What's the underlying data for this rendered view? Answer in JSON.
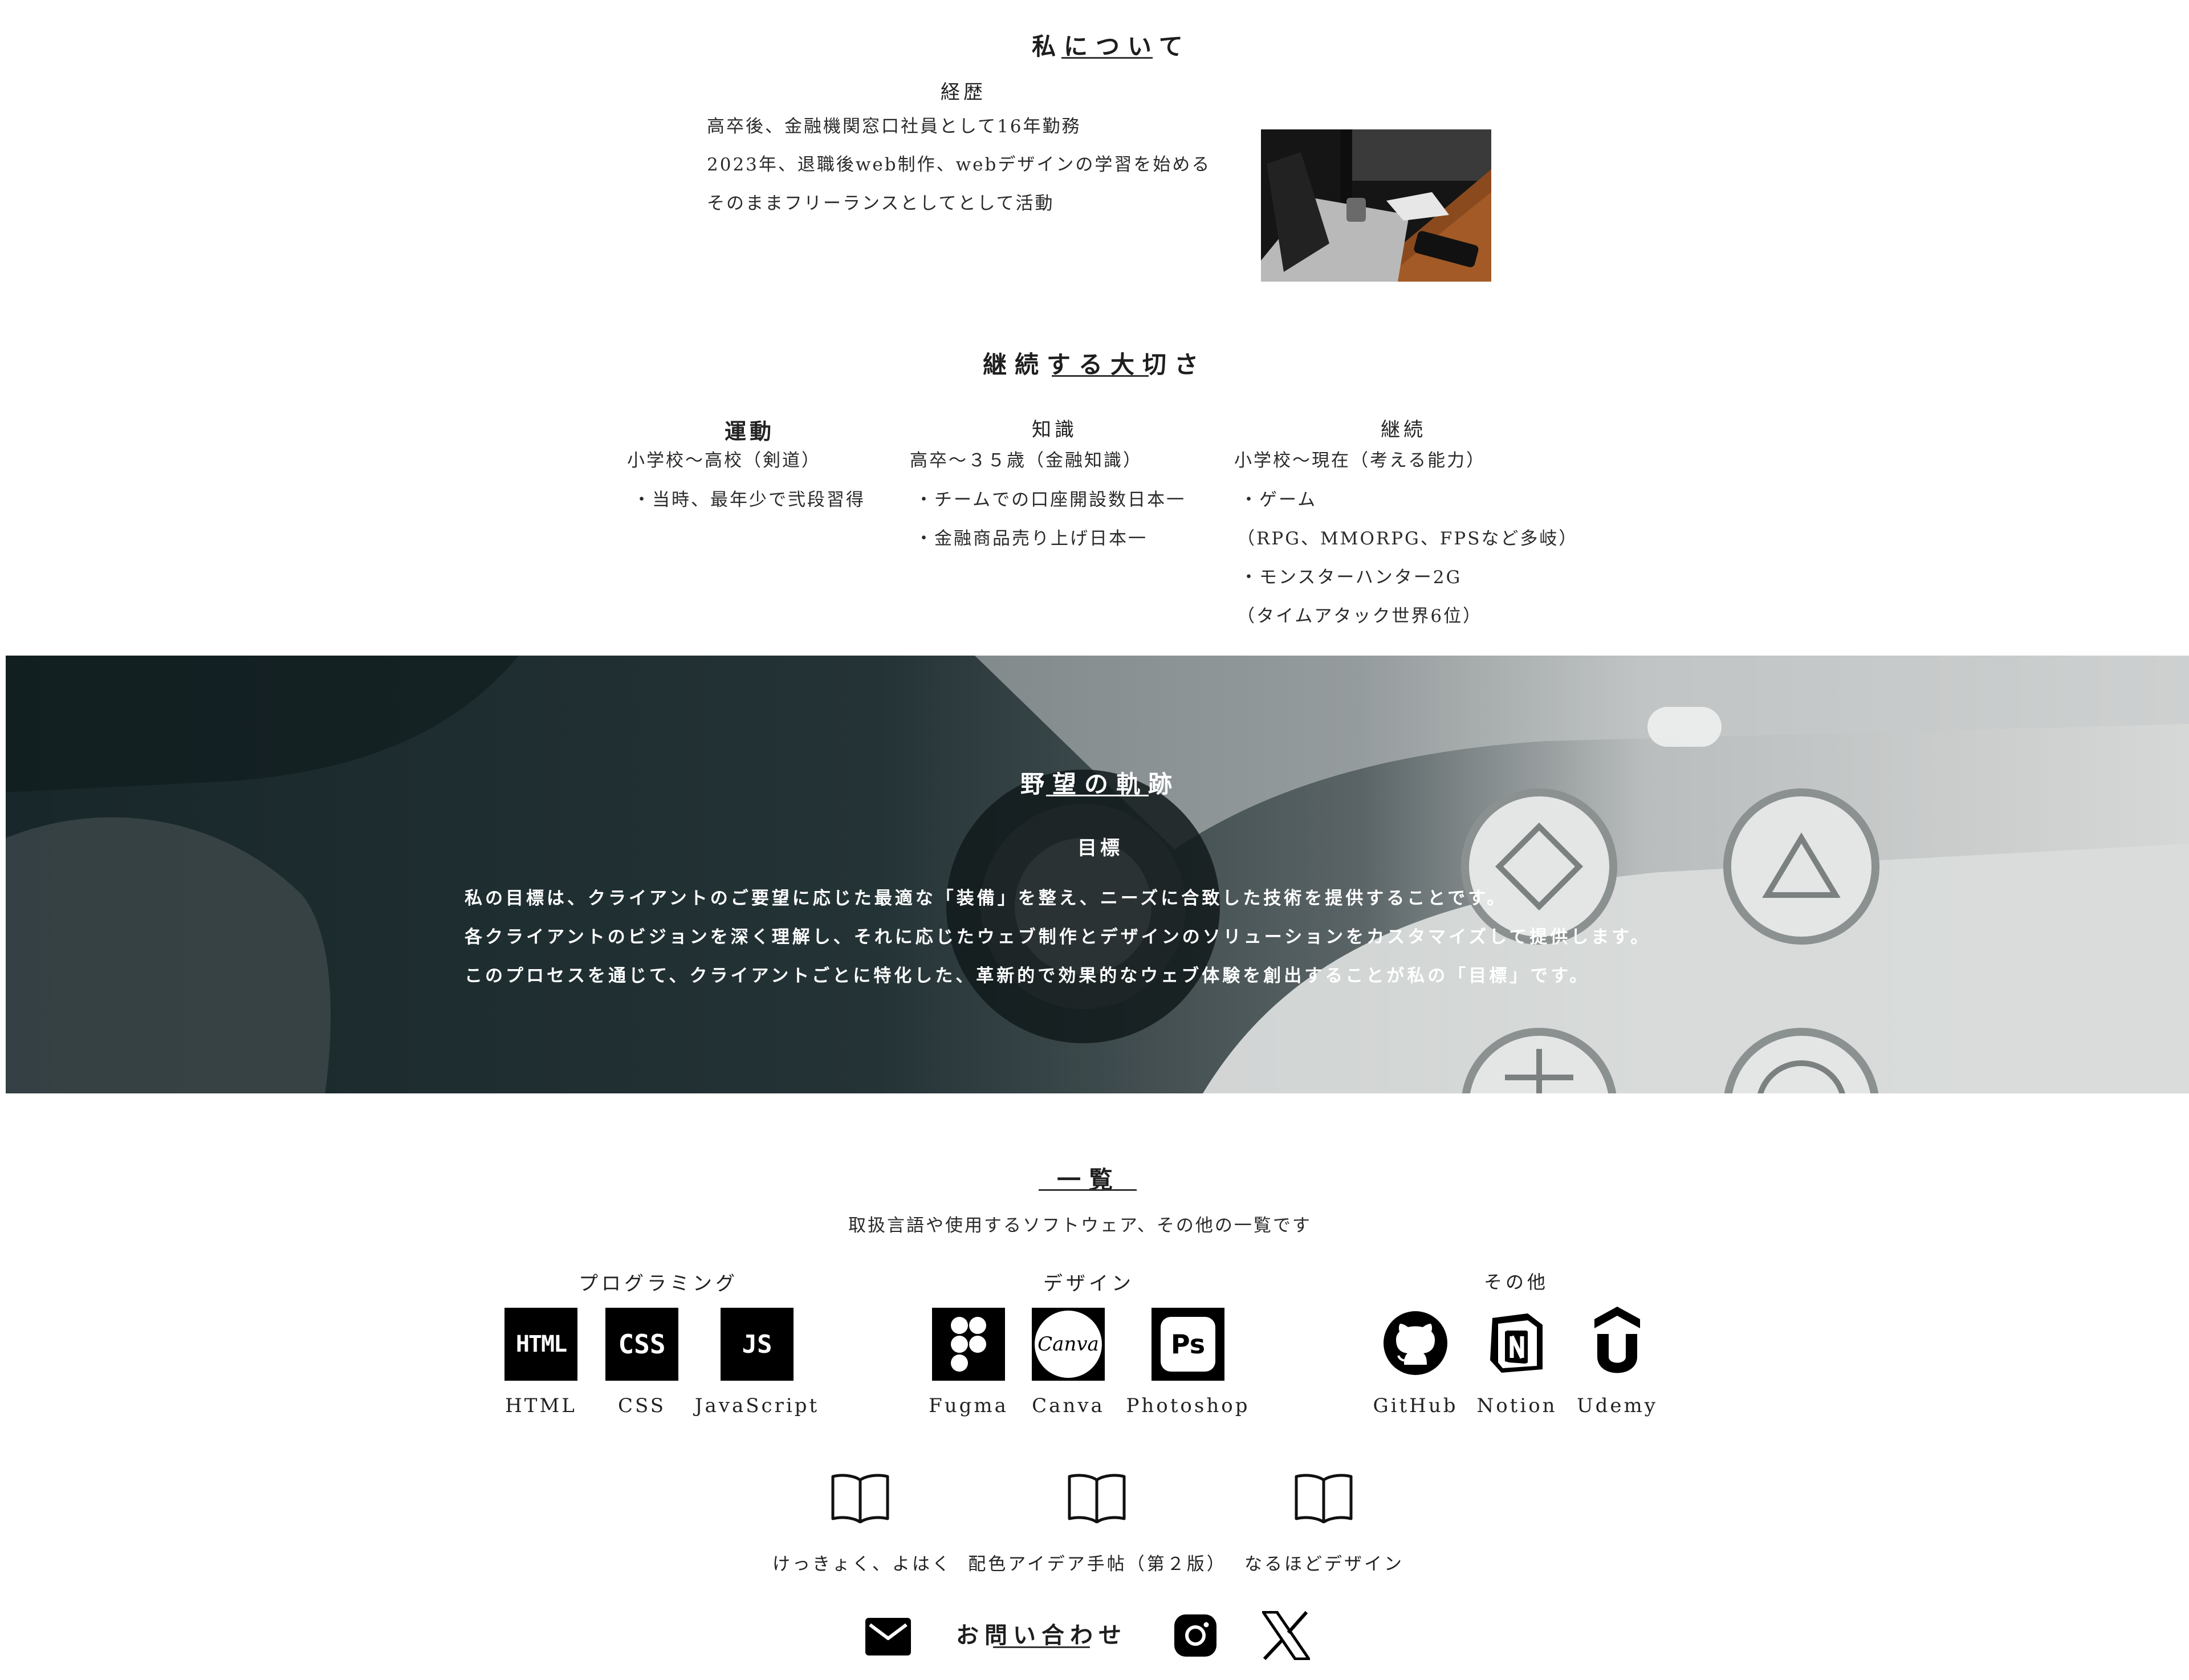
{
  "about": {
    "title": "私について",
    "career_heading": "経歴",
    "career_lines": [
      "高卒後、金融機関窓口社員として16年勤務",
      "2023年、退職後web制作、webデザインの学習を始める",
      "そのままフリーランスとしてとして活動"
    ]
  },
  "continuity": {
    "title": "継続する大切さ",
    "columns": [
      {
        "heading": "運動",
        "period": "小学校〜高校（剣道）",
        "items": [
          "・当時、最年少で弐段習得"
        ]
      },
      {
        "heading": "知識",
        "period": "高卒〜３５歳（金融知識）",
        "items": [
          "・チームでの口座開設数日本一",
          "・金融商品売り上げ日本一"
        ]
      },
      {
        "heading": "継続",
        "period": "小学校〜現在（考える能力）",
        "items": [
          "・ゲーム",
          "（RPG、MMORPG、FPSなど多岐）",
          "・モンスターハンター2G",
          "（タイムアタック世界6位）"
        ]
      }
    ]
  },
  "ambition": {
    "title": "野望の軌跡",
    "subheading": "目標",
    "lines": [
      "私の目標は、クライアントのご要望に応じた最適な「装備」を整え、ニーズに合致した技術を提供することです。",
      "各クライアントのビジョンを深く理解し、それに応じたウェブ制作とデザインのソリューションをカスタマイズして提供します。",
      "このプロセスを通じて、クライアントごとに特化した、革新的で効果的なウェブ体験を創出することが私の「目標」です。"
    ]
  },
  "list": {
    "title": "一覧",
    "description": "取扱言語や使用するソフトウェア、その他の一覧です",
    "groups": [
      {
        "heading": "プログラミング",
        "items": [
          {
            "label": "HTML",
            "icon": "html-icon",
            "glyph": "HTML"
          },
          {
            "label": "CSS",
            "icon": "css-icon",
            "glyph": "CSS"
          },
          {
            "label": "JavaScript",
            "icon": "js-icon",
            "glyph": "JS"
          }
        ]
      },
      {
        "heading": "デザイン",
        "items": [
          {
            "label": "Fugma",
            "icon": "figma-icon"
          },
          {
            "label": "Canva",
            "icon": "canva-icon",
            "glyph": "Canva"
          },
          {
            "label": "Photoshop",
            "icon": "photoshop-icon",
            "glyph": "Ps"
          }
        ]
      },
      {
        "heading": "その他",
        "items": [
          {
            "label": "GitHub",
            "icon": "github-icon"
          },
          {
            "label": "Notion",
            "icon": "notion-icon",
            "glyph": "N"
          },
          {
            "label": "Udemy",
            "icon": "udemy-icon"
          }
        ]
      }
    ],
    "books": [
      {
        "label": "けっきょく、よはく",
        "icon": "book-icon"
      },
      {
        "label": "配色アイデア手帖（第２版）",
        "icon": "book-icon"
      },
      {
        "label": "なるほどデザイン",
        "icon": "book-icon"
      }
    ]
  },
  "footer": {
    "contact_label": "お問い合わせ",
    "icons": [
      "mail-icon",
      "instagram-icon",
      "x-icon"
    ]
  }
}
